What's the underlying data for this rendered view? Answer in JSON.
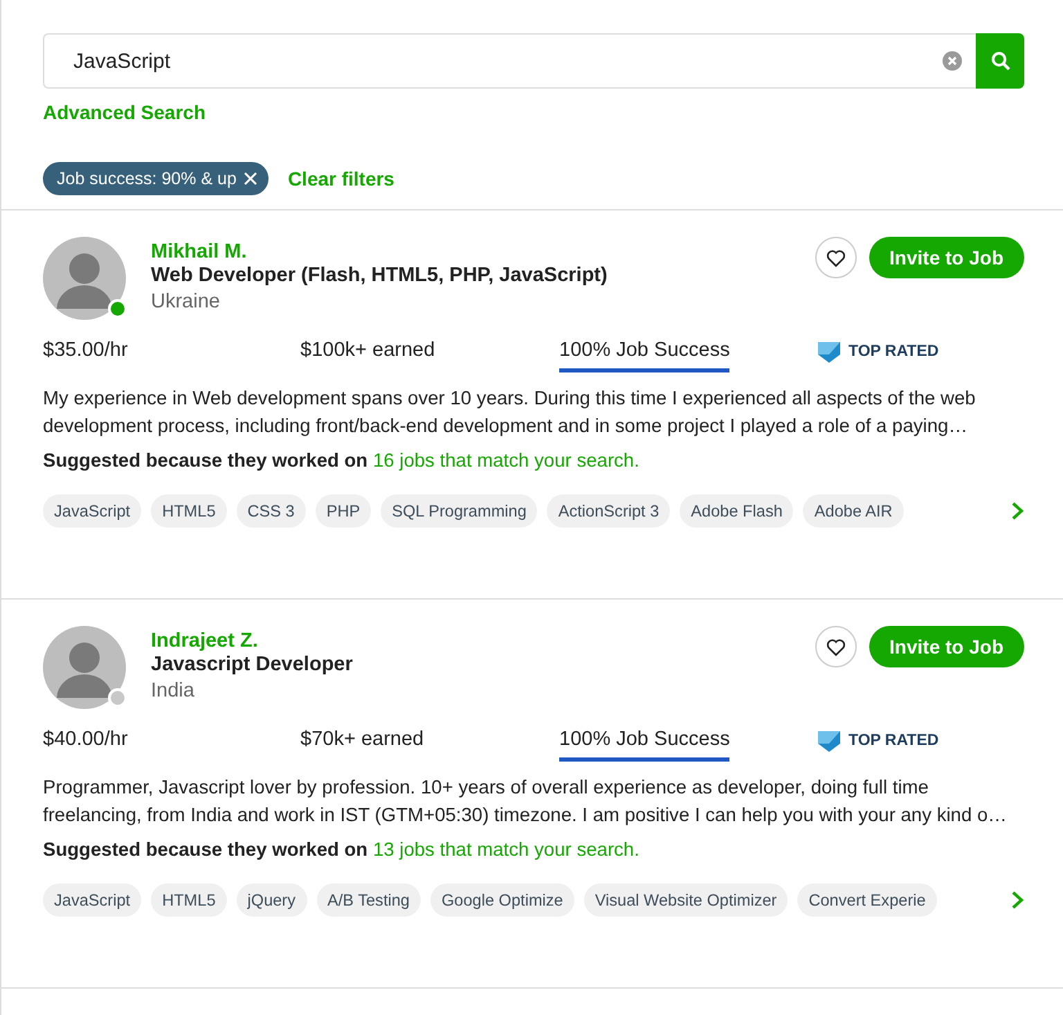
{
  "search": {
    "value": "JavaScript",
    "advanced_link": "Advanced Search"
  },
  "filters": {
    "chips": [
      {
        "label": "Job success: 90% & up"
      }
    ],
    "clear_link": "Clear filters"
  },
  "freelancers": [
    {
      "name": "Mikhail M.",
      "title": "Web Developer (Flash, HTML5, PHP, JavaScript)",
      "country": "Ukraine",
      "online": true,
      "rate": "$35.00/hr",
      "earned": "$100k+ earned",
      "job_success": "100% Job Success",
      "level": 1,
      "badge": "TOP RATED",
      "description": "My experience in Web development spans over 10 years. During this time I experienced all aspects of the web development process, including front/back-end development and in some project I played a role of a paying…",
      "suggestion": "Suggested because they worked on ",
      "suggestion_link": "16 jobs that match your search.",
      "invite": "Invite to Job",
      "saved": false,
      "skills": [
        "JavaScript",
        "HTML5",
        "CSS 3",
        "PHP",
        "SQL Programming",
        "ActionScript 3",
        "Adobe Flash",
        "Adobe AIR"
      ]
    },
    {
      "name": "Indrajeet Z.",
      "title": "Javascript Developer",
      "country": "India",
      "online": false,
      "rate": "$40.00/hr",
      "earned": "$70k+ earned",
      "job_success": "100% Job Success",
      "level": 1,
      "badge": "TOP RATED",
      "description": "Programmer, Javascript lover by profession. 10+ years of overall experience as developer, doing full time freelancing, from India and work in IST (GTM+05:30) timezone. I am positive I can help you with your any kind o…",
      "suggestion": "Suggested because they worked on ",
      "suggestion_link": "13 jobs that match your search.",
      "invite": "Invite to Job",
      "saved": false,
      "skills": [
        "JavaScript",
        "HTML5",
        "jQuery",
        "A/B Testing",
        "Google Optimize",
        "Visual Website Optimizer",
        "Convert Experie"
      ]
    }
  ]
}
